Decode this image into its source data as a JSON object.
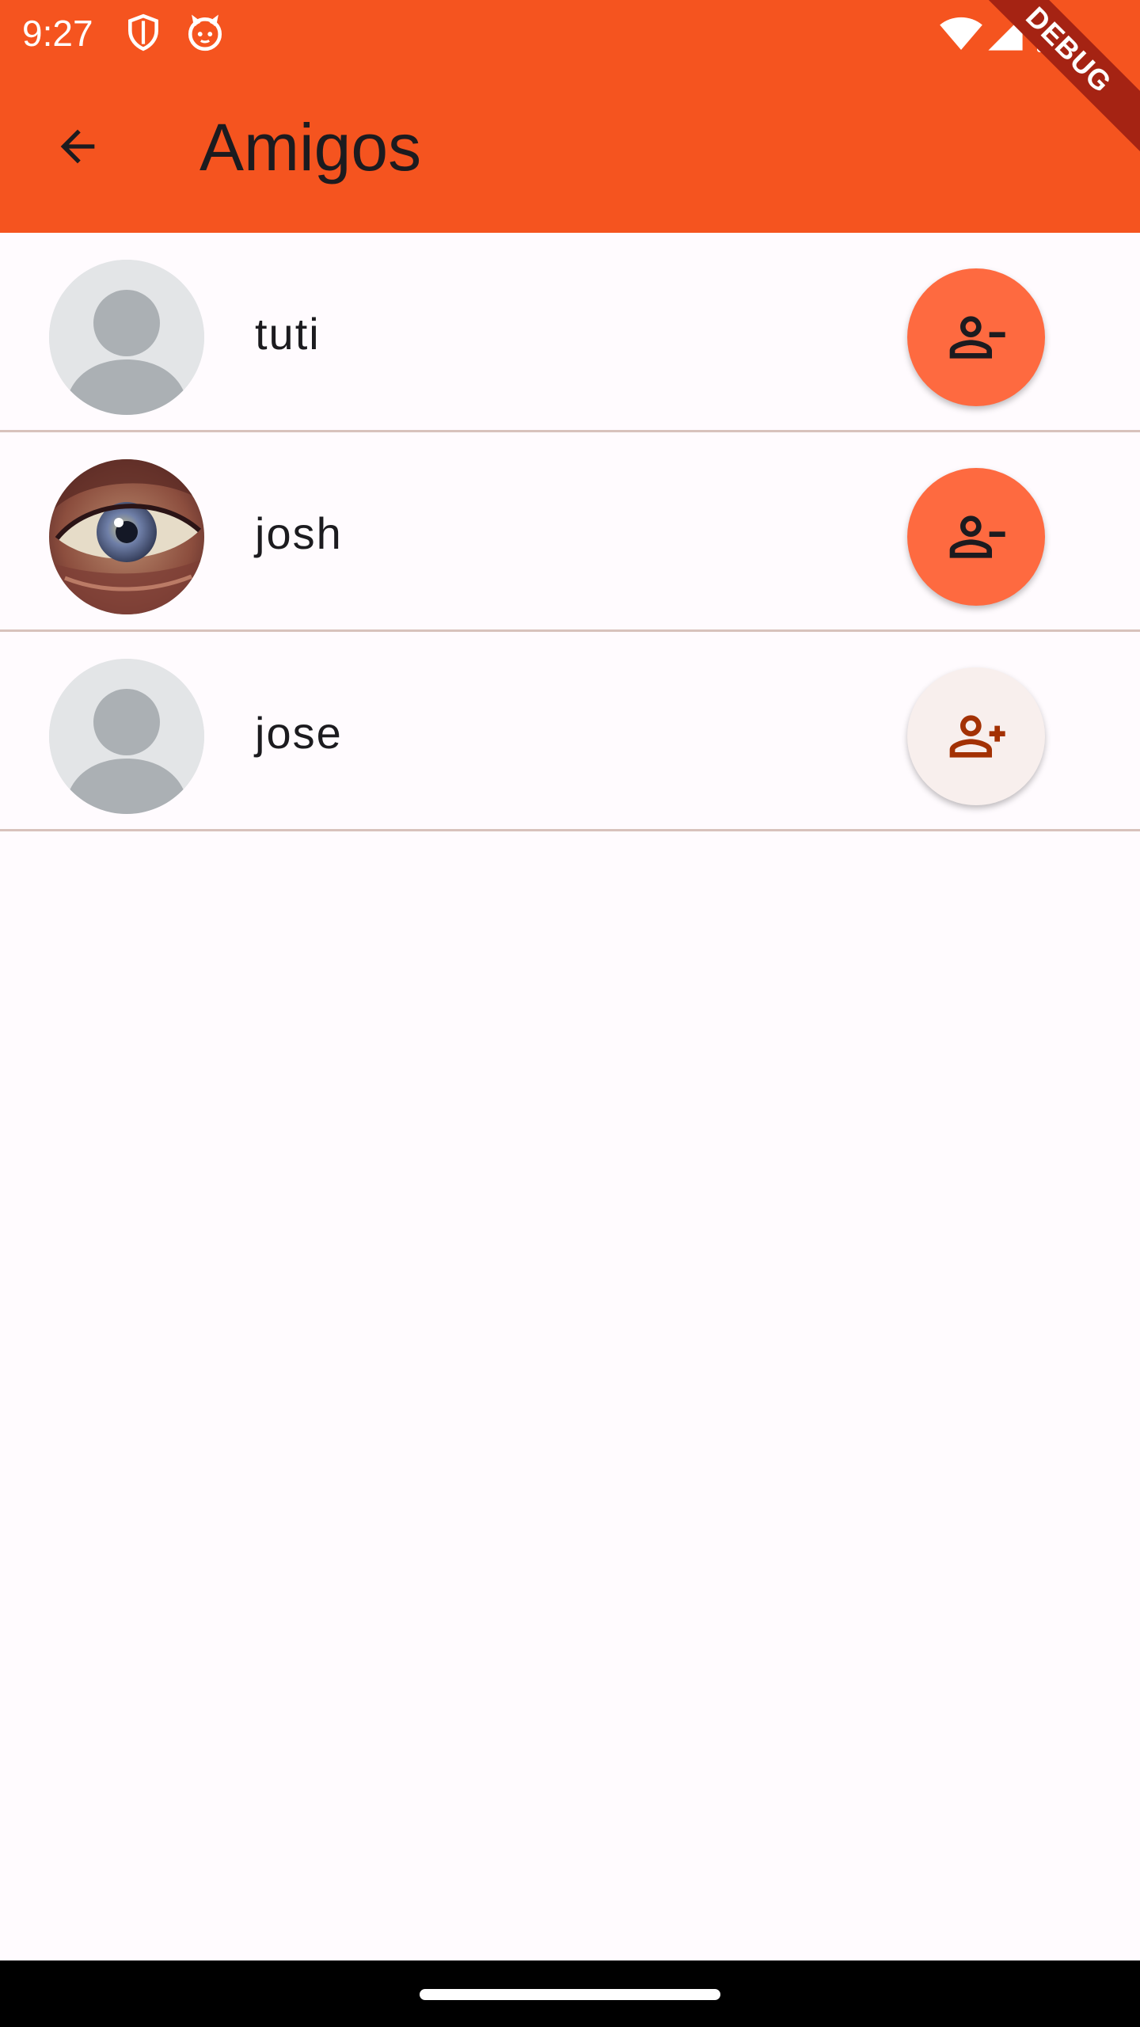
{
  "status_bar": {
    "time": "9:27",
    "left_icons": [
      "shield-icon",
      "cat-face-icon"
    ],
    "right_icons": [
      "wifi-icon",
      "signal-icon",
      "battery-icon"
    ]
  },
  "app_bar": {
    "title": "Amigos",
    "back_icon": "arrow-back-icon",
    "debug_label": "DEBUG"
  },
  "friends": [
    {
      "name": "tuti",
      "avatar": "default-avatar",
      "action": "remove-friend",
      "action_icon": "person-remove-icon"
    },
    {
      "name": "josh",
      "avatar": "eye-painting-photo",
      "action": "remove-friend",
      "action_icon": "person-remove-icon"
    },
    {
      "name": "jose",
      "avatar": "default-avatar",
      "action": "add-friend",
      "action_icon": "person-add-icon"
    }
  ],
  "colors": {
    "primary": "#f5541f",
    "fab_remove": "#fe6a40",
    "fab_add": "#f8efed",
    "add_icon": "#a33104",
    "divider": "#d8c2bc",
    "background": "#fffbfe",
    "debug_banner": "#a52313"
  }
}
